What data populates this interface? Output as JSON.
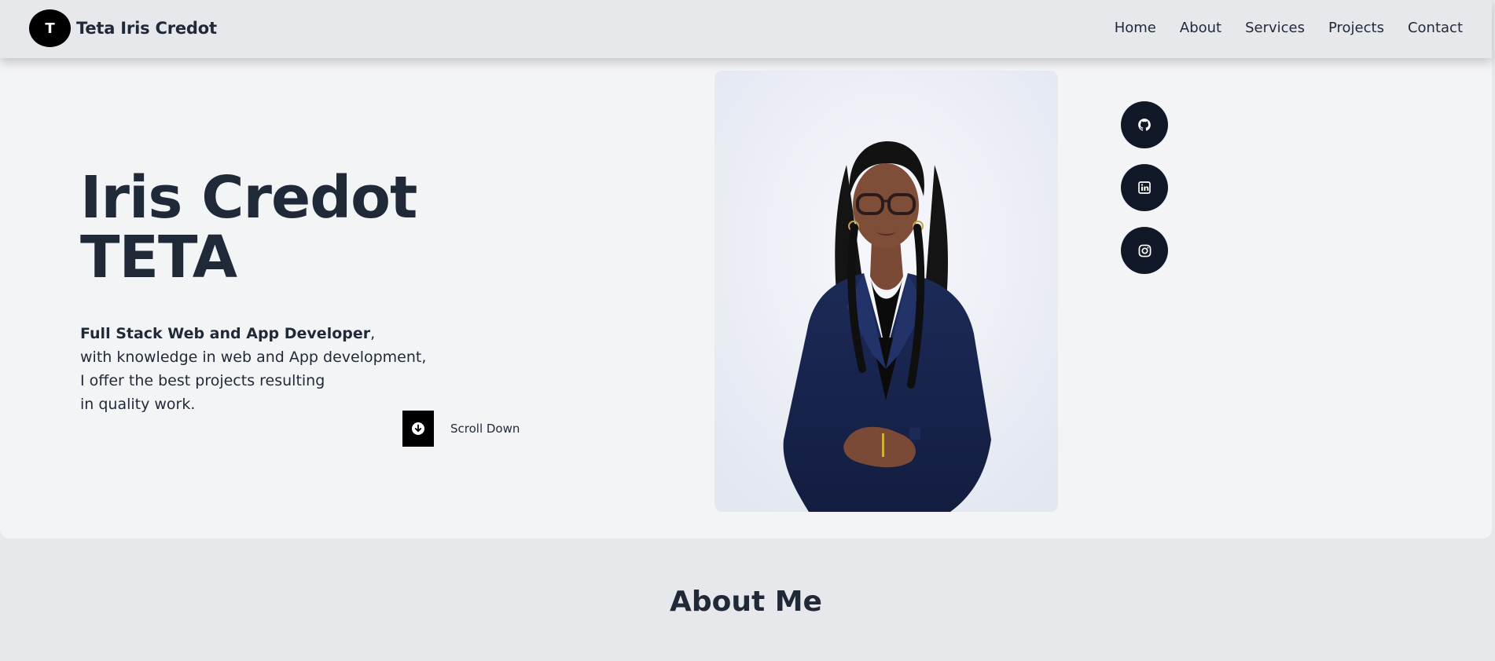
{
  "brand": {
    "logo_letter": "T",
    "name": "Teta Iris Credot"
  },
  "nav": {
    "items": [
      {
        "label": "Home"
      },
      {
        "label": "About"
      },
      {
        "label": "Services"
      },
      {
        "label": "Projects"
      },
      {
        "label": "Contact"
      }
    ]
  },
  "hero": {
    "title_line1": "Iris Credot",
    "title_line2": "TETA",
    "desc_strong": "Full Stack Web and App Developer",
    "desc_comma": ",",
    "desc_line2": "with knowledge in web and App development,",
    "desc_line3": "I offer the best projects resulting",
    "desc_line4": "in quality work.",
    "scroll_label": "Scroll Down",
    "scroll_icon": "arrow-down-circle-icon"
  },
  "social": [
    {
      "icon": "github-icon"
    },
    {
      "icon": "linkedin-icon"
    },
    {
      "icon": "instagram-icon"
    }
  ],
  "about": {
    "title": "About Me"
  },
  "colors": {
    "header_bg": "#e7e8eb",
    "hero_bg": "#f3f4f6",
    "text": "#1f2937",
    "social_bg": "#111827",
    "accent_black": "#000000"
  }
}
